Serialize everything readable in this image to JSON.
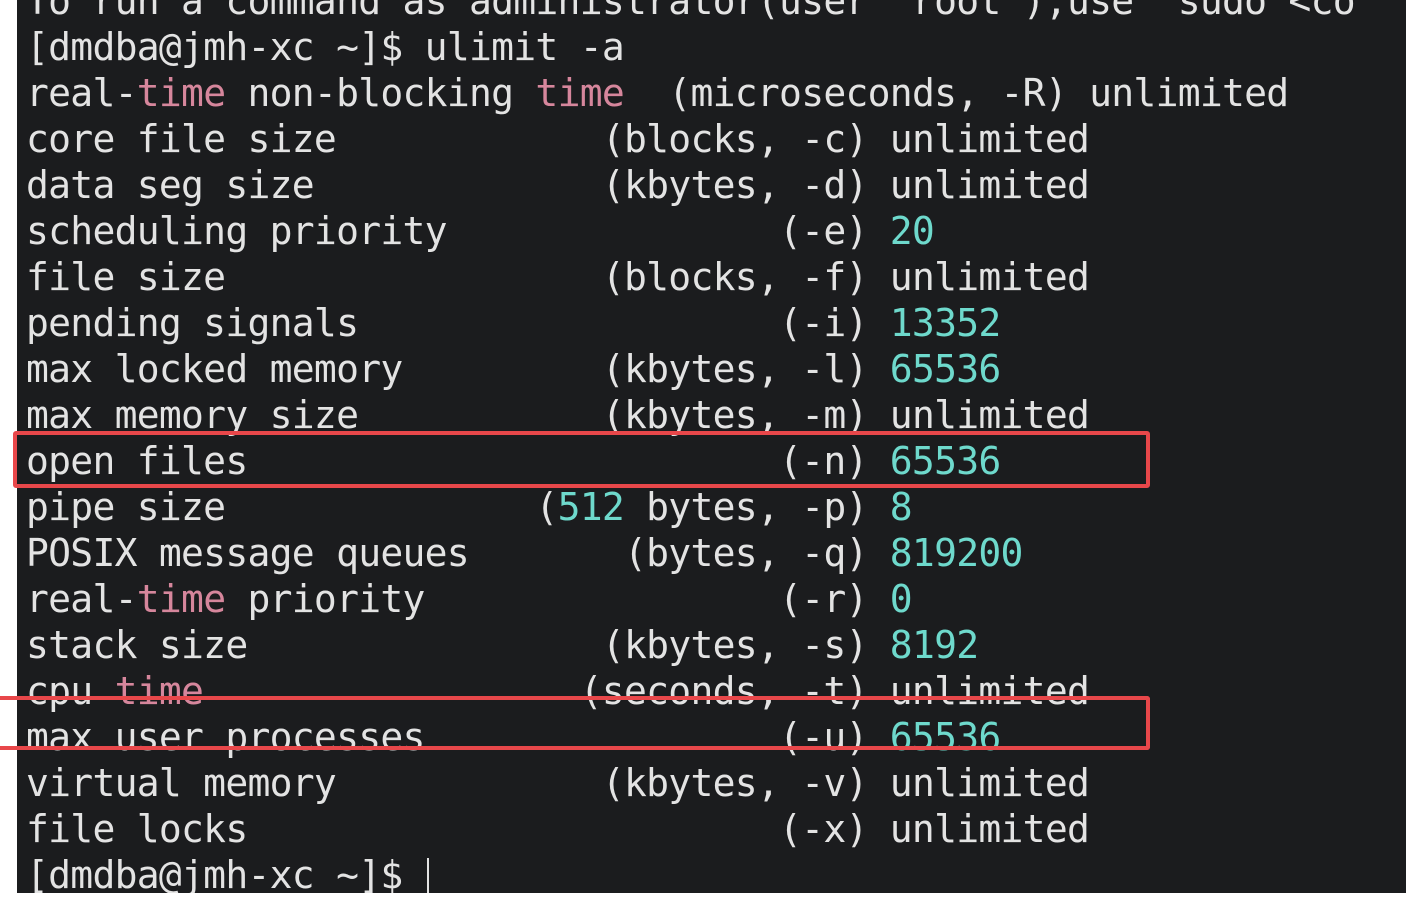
{
  "terminal": {
    "top_partial": "To run a command as administrator(user \"root\"),use \"sudo <co",
    "prompt": "[dmdba@jmh-xc ~]$ ",
    "command": "ulimit -a",
    "rows": [
      {
        "pre": "real-",
        "kw": "time",
        "mid": " non-blocking ",
        "kw2": "time",
        "pad": "  (microseconds, -R) ",
        "value": "unlimited"
      },
      {
        "name": "core file size            ",
        "pad": "(blocks, -c) ",
        "value": "unlimited"
      },
      {
        "name": "data seg size             ",
        "pad": "(kbytes, -d) ",
        "value": "unlimited"
      },
      {
        "name": "scheduling priority               ",
        "pad": "(-e) ",
        "value": "20"
      },
      {
        "name": "file size                 ",
        "pad": "(blocks, -f) ",
        "value": "unlimited"
      },
      {
        "name": "pending signals                   ",
        "pad": "(-i) ",
        "value": "13352"
      },
      {
        "name": "max locked memory         ",
        "pad": "(kbytes, -l) ",
        "value": "65536"
      },
      {
        "name": "max memory size           ",
        "pad": "(kbytes, -m) ",
        "value": "unlimited"
      },
      {
        "name": "open files                        ",
        "pad": "(-n) ",
        "value": "65536"
      },
      {
        "name": "pipe size              (",
        "num": "512",
        "pad": " bytes, -p) ",
        "value": "8"
      },
      {
        "name": "POSIX message queues       ",
        "pad": "(bytes, -q) ",
        "value": "819200"
      },
      {
        "pre": "real-",
        "kw": "time",
        "mid": " priority                ",
        "pad": "(-r) ",
        "value": "0"
      },
      {
        "name": "stack size                ",
        "pad": "(kbytes, -s) ",
        "value": "8192"
      },
      {
        "pre": "cpu ",
        "kw": "time",
        "mid": "                 ",
        "pad": "(seconds, -t) ",
        "value": "unlimited"
      },
      {
        "name": "max user processes                ",
        "pad": "(-u) ",
        "value": "65536"
      },
      {
        "name": "virtual memory            ",
        "pad": "(kbytes, -v) ",
        "value": "unlimited"
      },
      {
        "name": "file locks                        ",
        "pad": "(-x) ",
        "value": "unlimited"
      }
    ],
    "final_prompt": "[dmdba@jmh-xc ~]$ "
  },
  "annotations": {
    "highlight_color": "#e8474a",
    "highlighted_rows": [
      "open files",
      "max user processes"
    ]
  },
  "colors": {
    "background": "#1b1c1e",
    "text": "#e3e3e3",
    "keyword": "#d6869c",
    "number": "#6ed9cc"
  }
}
